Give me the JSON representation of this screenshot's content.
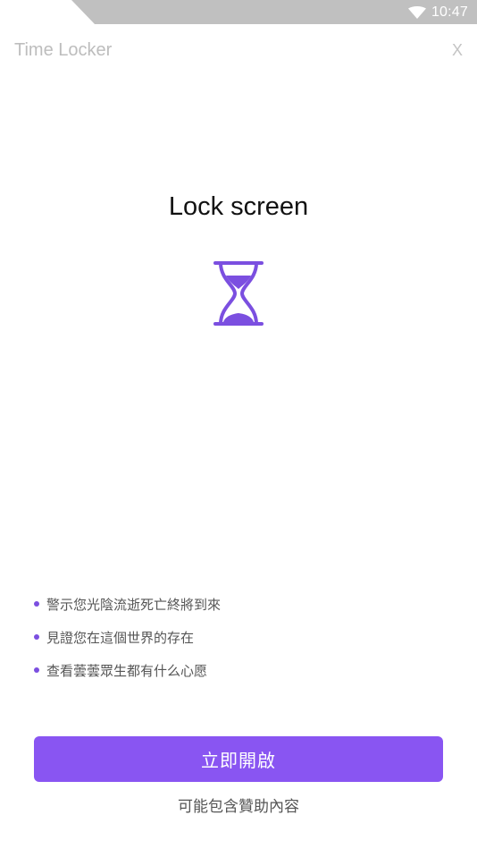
{
  "status_bar": {
    "time": "10:47",
    "wifi_icon": "wifi-icon",
    "color": "#c0c0c0"
  },
  "header": {
    "app_title": "Time Locker",
    "close_label": "X"
  },
  "feature": {
    "title": "Lock screen",
    "icon": "hourglass-icon",
    "icon_color": "#7b4fe0"
  },
  "bullets": [
    "警示您光陰流逝死亡終將到來",
    "見證您在這個世界的存在",
    "查看蕓蕓眾生都有什么心愿"
  ],
  "actions": {
    "enable_label": "立即開啟",
    "button_color": "#8955f2",
    "sponsor_note": "可能包含贊助內容"
  }
}
